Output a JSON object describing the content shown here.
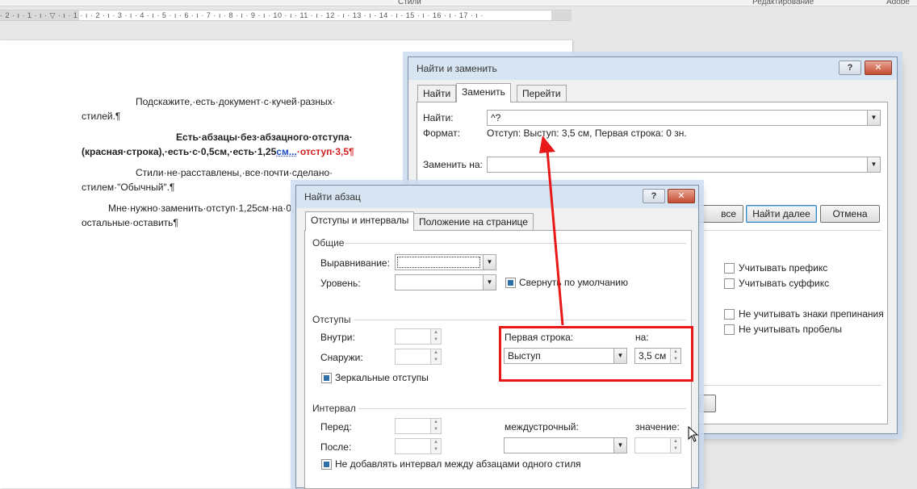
{
  "word": {
    "ribbon": {
      "styles_label": "Стили",
      "editing_label": "Редактирование",
      "adobe_label": "Adobe"
    },
    "ruler_numbers": "· 2 · ı · 1 · ı · ▽ · ı · 1 · ı · 2 · ı · 3 · ı · 4 · ı · 5 · ı · 6 · ı · 7 · ı · 8 · ı · 9 · ı · 10 · ı · 11 · ı · 12 · ı · 13 · ı · 14 · ı · 15 · ı · 16 · ı · 17 · ı ·",
    "document": {
      "p1_line1": "Подскажите,·есть·документ·с·кучей·разных·",
      "p1_line2": "стилей.¶",
      "p2_line1": "Есть·абзацы·без·абзацного·отступа·",
      "p2_line2_a": "(красная·строка),·есть·с·0,5см,·есть·1,25",
      "p2_line2_link": "см...",
      "p2_line2_red": "·отступ·3,5¶",
      "p3_line1": "Стили·не·расставлены,·все·почти·сделано·",
      "p3_line2": "стилем·\"Обычный\".¶",
      "p4_line1": "Мне·нужно·заменить·отступ·1,25см·на·0,",
      "p4_line2": "остальные·оставить¶"
    }
  },
  "find_replace": {
    "title": "Найти и заменить",
    "help_label": "?",
    "close_label": "✕",
    "tabs": [
      {
        "label": "Найти"
      },
      {
        "label": "Заменить"
      },
      {
        "label": "Перейти"
      }
    ],
    "find_label": "Найти:",
    "find_value": "^?",
    "format_label": "Формат:",
    "format_value": "Отступ: Выступ:  3,5 см, Первая строка:  0 зн.",
    "replace_label": "Заменить на:",
    "replace_value": "",
    "buttons": {
      "replace_all_partial": "все",
      "find_next": "Найти далее",
      "cancel": "Отмена"
    },
    "options": [
      {
        "label": "Учитывать префикс",
        "checked": false
      },
      {
        "label": "Учитывать суффикс",
        "checked": false
      },
      {
        "label": "Не учитывать знаки препинания",
        "checked": false
      },
      {
        "label": "Не учитывать пробелы",
        "checked": false
      }
    ]
  },
  "find_paragraph": {
    "title": "Найти абзац",
    "help_label": "?",
    "close_label": "✕",
    "tabs": [
      {
        "label": "Отступы и интервалы"
      },
      {
        "label": "Положение на странице"
      }
    ],
    "general": {
      "title": "Общие",
      "alignment_label": "Выравнивание:",
      "alignment_value": "",
      "level_label": "Уровень:",
      "level_value": "",
      "collapse_label": "Свернуть по умолчанию",
      "collapse_checked": true
    },
    "indents": {
      "title": "Отступы",
      "inside_label": "Внутри:",
      "inside_value": "",
      "outside_label": "Снаружи:",
      "outside_value": "",
      "first_line_label": "Первая строка:",
      "first_line_value": "Выступ",
      "by_label": "на:",
      "by_value": "3,5 см",
      "mirror_label": "Зеркальные отступы",
      "mirror_checked": true
    },
    "spacing": {
      "title": "Интервал",
      "before_label": "Перед:",
      "before_value": "",
      "after_label": "После:",
      "after_value": "",
      "line_label": "междустрочный:",
      "line_value": "",
      "value_label": "значение:",
      "value_value": "",
      "no_space_label": "Не добавлять интервал между абзацами одного стиля",
      "no_space_checked": true
    }
  },
  "colors": {
    "highlight": "#e81818",
    "accent": "#2f6fa7"
  }
}
